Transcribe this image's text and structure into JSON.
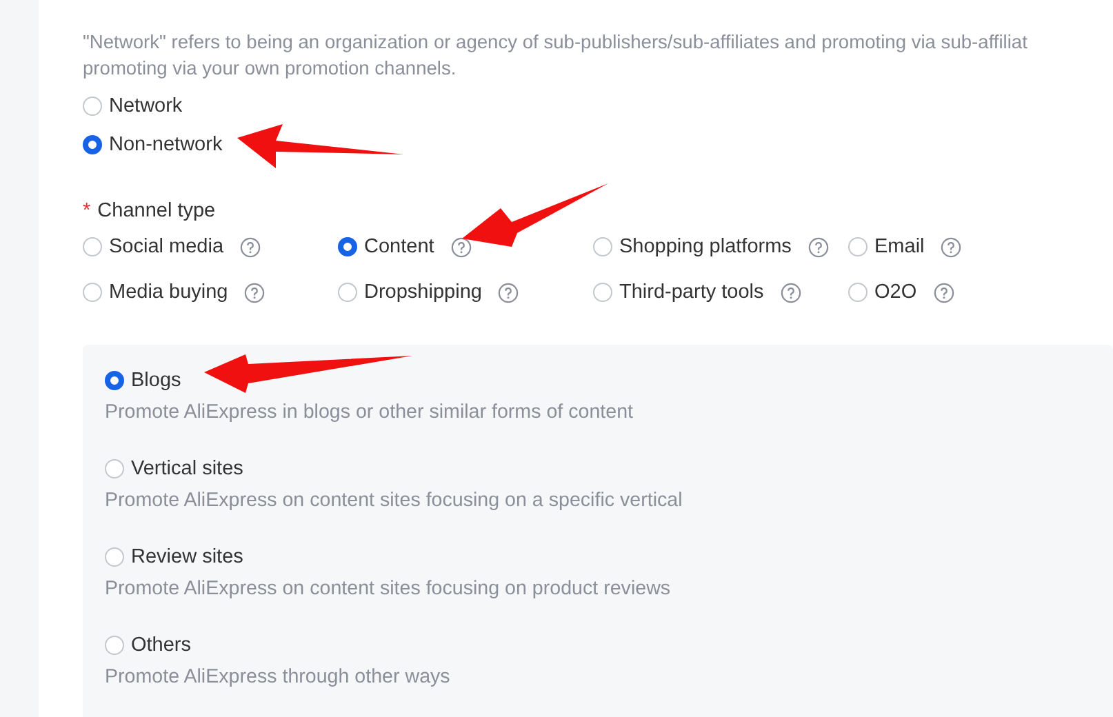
{
  "hint_lines": [
    "\"Network\" refers to being an organization or agency of sub-publishers/sub-affiliates and promoting via sub-affiliat",
    "promoting via your own promotion channels."
  ],
  "attribute_options": [
    {
      "label": "Network",
      "selected": false
    },
    {
      "label": "Non-network",
      "selected": true
    }
  ],
  "channel_type": {
    "required_mark": "*",
    "label": "Channel type",
    "options": [
      {
        "label": "Social media",
        "selected": false
      },
      {
        "label": "Content",
        "selected": true
      },
      {
        "label": "Shopping platforms",
        "selected": false
      },
      {
        "label": "Email",
        "selected": false
      },
      {
        "label": "Media buying",
        "selected": false
      },
      {
        "label": "Dropshipping",
        "selected": false
      },
      {
        "label": "Third-party tools",
        "selected": false
      },
      {
        "label": "O2O",
        "selected": false
      }
    ]
  },
  "content_options": [
    {
      "label": "Blogs",
      "description": "Promote AliExpress in blogs or other similar forms of content",
      "selected": true
    },
    {
      "label": "Vertical sites",
      "description": "Promote AliExpress on content sites focusing on a specific vertical",
      "selected": false
    },
    {
      "label": "Review sites",
      "description": "Promote AliExpress on content sites focusing on product reviews",
      "selected": false
    },
    {
      "label": "Others",
      "description": "Promote AliExpress through other ways",
      "selected": false
    }
  ]
}
